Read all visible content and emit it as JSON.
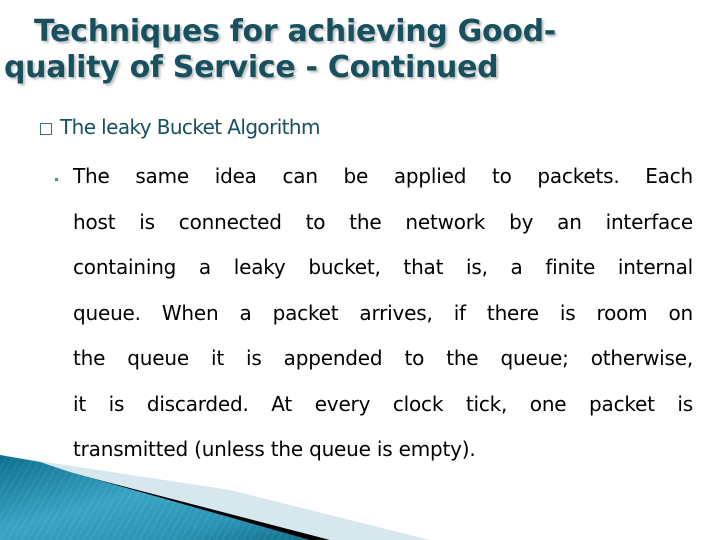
{
  "slide": {
    "title_lines": [
      "Techniques for achieving Good-",
      "quality of Service - Continued"
    ],
    "subheading": "The leaky Bucket Algorithm",
    "body_lines": [
      "The same idea can be applied to packets. Each",
      "host is connected to the network by an interface",
      "containing a leaky bucket, that is, a finite internal",
      "queue. When a packet arrives, if there is room on",
      "the queue it is appended to the queue; otherwise,",
      "it is discarded. At every clock tick, one packet is",
      "transmitted (unless the queue is empty)."
    ],
    "colors": {
      "title": "#17505e",
      "body": "#000000",
      "accent_teal": "#1d7f9c",
      "accent_light": "#d6e8ee"
    },
    "icons": {
      "subheading_bullet": "square-outline-bullet",
      "body_bullet": "small-dot-bullet",
      "decoration": "teal-wedge-swoosh"
    }
  }
}
